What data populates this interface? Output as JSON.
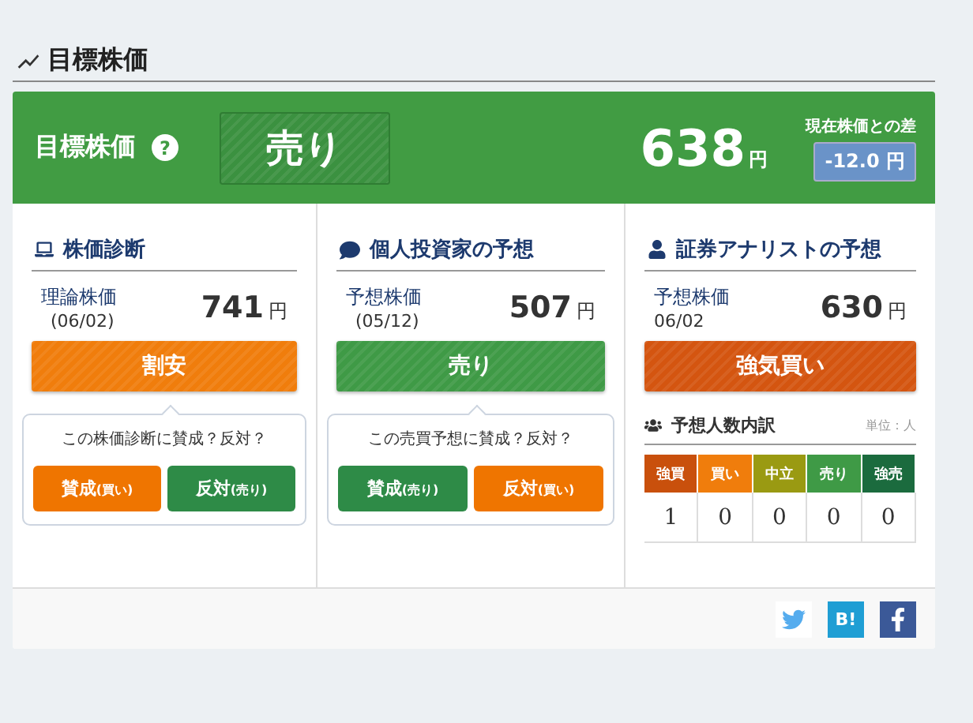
{
  "heading": "目標株価",
  "banner": {
    "label": "目標株価",
    "help": "?",
    "rating": "売り",
    "price": "638",
    "unit": "円",
    "diff_label": "現在株価との差",
    "diff": "-12.0",
    "diff_unit": "円"
  },
  "columns": [
    {
      "title": "株価診断",
      "price_label": "理論株価",
      "date": "(06/02)",
      "price": "741",
      "unit": "円",
      "rating": {
        "text": "割安",
        "color": "#f07d0c"
      },
      "vote": {
        "question": "この株価診断に賛成？反対？",
        "buttons": [
          {
            "label": "賛成",
            "sub": "(買い)",
            "color": "#ef7500"
          },
          {
            "label": "反対",
            "sub": "(売り)",
            "color": "#2e8b47"
          }
        ]
      }
    },
    {
      "title": "個人投資家の予想",
      "price_label": "予想株価",
      "date": "(05/12)",
      "price": "507",
      "unit": "円",
      "rating": {
        "text": "売り",
        "color": "#3f9a46"
      },
      "vote": {
        "question": "この売買予想に賛成？反対？",
        "buttons": [
          {
            "label": "賛成",
            "sub": "(売り)",
            "color": "#2e8b47"
          },
          {
            "label": "反対",
            "sub": "(買い)",
            "color": "#ef7500"
          }
        ]
      }
    },
    {
      "title": "証券アナリストの予想",
      "price_label": "予想株価",
      "date": "06/02",
      "price": "630",
      "unit": "円",
      "rating": {
        "text": "強気買い",
        "color": "#d45510"
      },
      "breakdown": {
        "title": "予想人数内訳",
        "unit_note": "単位：人",
        "cells": [
          {
            "label": "強買",
            "value": "1",
            "color": "#c9500c"
          },
          {
            "label": "買い",
            "value": "0",
            "color": "#f07d0c"
          },
          {
            "label": "中立",
            "value": "0",
            "color": "#9a9a12"
          },
          {
            "label": "売り",
            "value": "0",
            "color": "#3f9a46"
          },
          {
            "label": "強売",
            "value": "0",
            "color": "#1b6b3e"
          }
        ]
      }
    }
  ],
  "share": [
    {
      "kind": "twitter"
    },
    {
      "kind": "hatena",
      "text": "B!"
    },
    {
      "kind": "facebook"
    }
  ]
}
